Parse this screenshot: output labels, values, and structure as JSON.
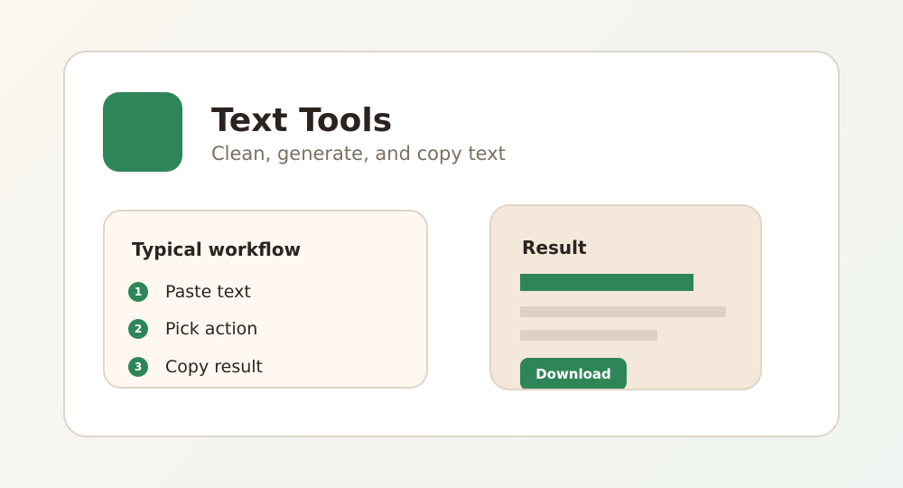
{
  "header": {
    "title": "Text Tools",
    "subtitle": "Clean, generate, and copy text"
  },
  "workflow": {
    "title": "Typical workflow",
    "steps": [
      {
        "number": "1",
        "label": "Paste text"
      },
      {
        "number": "2",
        "label": "Pick action"
      },
      {
        "number": "3",
        "label": "Copy result"
      }
    ]
  },
  "result": {
    "title": "Result",
    "download_label": "Download"
  },
  "colors": {
    "accent": "#2e8658",
    "card_border": "#ddd5c8",
    "workflow_bg": "#fff8f0",
    "result_bg": "#f4e8da",
    "placeholder_line": "#ddd1c3",
    "text_primary": "#2b2320",
    "text_secondary": "#7a6f64"
  }
}
